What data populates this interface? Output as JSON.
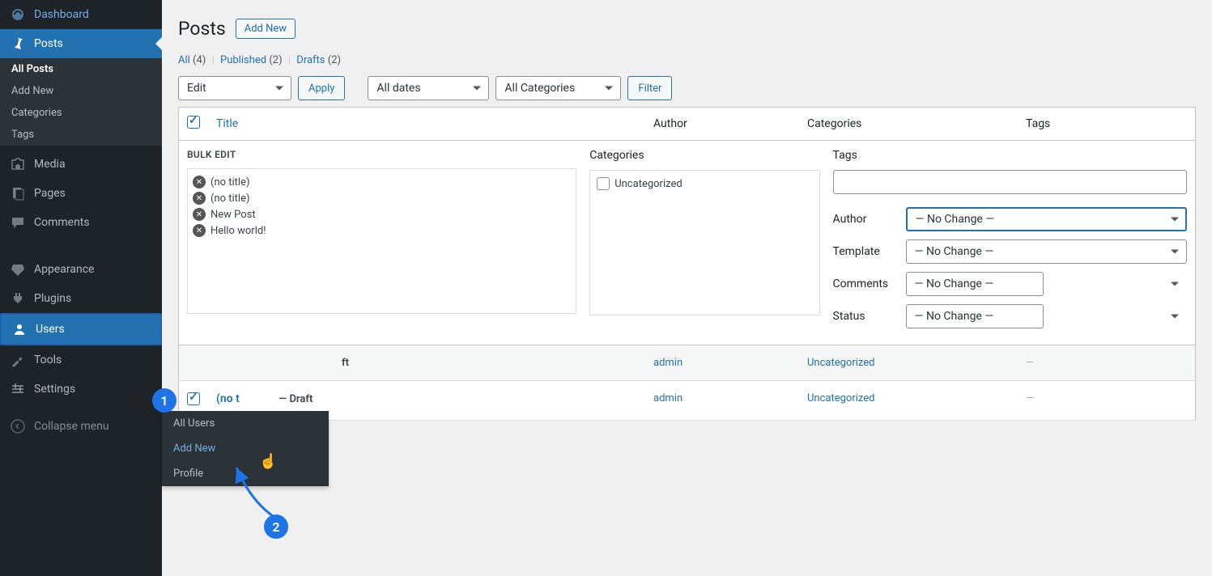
{
  "sidebar": {
    "items": [
      {
        "label": "Dashboard",
        "icon": "dashboard"
      },
      {
        "label": "Posts",
        "icon": "pin",
        "current": true,
        "submenu": [
          {
            "label": "All Posts",
            "current": true
          },
          {
            "label": "Add New"
          },
          {
            "label": "Categories"
          },
          {
            "label": "Tags"
          }
        ]
      },
      {
        "label": "Media",
        "icon": "media"
      },
      {
        "label": "Pages",
        "icon": "pages"
      },
      {
        "label": "Comments",
        "icon": "comments"
      },
      {
        "label": "Appearance",
        "icon": "appearance"
      },
      {
        "label": "Plugins",
        "icon": "plugins"
      },
      {
        "label": "Users",
        "icon": "users",
        "highlighted": true
      },
      {
        "label": "Tools",
        "icon": "tools"
      },
      {
        "label": "Settings",
        "icon": "settings"
      },
      {
        "label": "Collapse menu",
        "icon": "collapse"
      }
    ],
    "flyout": {
      "items": [
        {
          "label": "All Users"
        },
        {
          "label": "Add New",
          "hover": true
        },
        {
          "label": "Profile"
        }
      ]
    }
  },
  "page": {
    "title": "Posts",
    "add_new": "Add New"
  },
  "subsubsub": {
    "all": {
      "label": "All",
      "count": "(4)"
    },
    "published": {
      "label": "Published",
      "count": "(2)"
    },
    "drafts": {
      "label": "Drafts",
      "count": "(2)"
    }
  },
  "tablenav": {
    "bulk_action": "Edit",
    "apply": "Apply",
    "dates": "All dates",
    "categories": "All Categories",
    "filter": "Filter"
  },
  "table": {
    "headers": {
      "title": "Title",
      "author": "Author",
      "categories": "Categories",
      "tags": "Tags"
    }
  },
  "bulk_edit": {
    "title": "BULK EDIT",
    "posts": [
      {
        "title": "(no title)"
      },
      {
        "title": "(no title)"
      },
      {
        "title": "New Post"
      },
      {
        "title": "Hello world!"
      }
    ],
    "cats_label": "Categories",
    "cat_items": [
      {
        "label": "Uncategorized"
      }
    ],
    "tags_label": "Tags",
    "fields": {
      "author": {
        "label": "Author",
        "value": "— No Change —"
      },
      "template": {
        "label": "Template",
        "value": "— No Change —"
      },
      "comments": {
        "label": "Comments",
        "value": "— No Change —"
      },
      "status": {
        "label": "Status",
        "value": "— No Change —"
      }
    }
  },
  "rows": [
    {
      "title_suffix": "ft",
      "state": "",
      "author": "admin",
      "categories": "Uncategorized",
      "tags": "—"
    },
    {
      "title": "(no t",
      "title_suffix": "— Draft",
      "author": "admin",
      "categories": "Uncategorized",
      "tags": "—"
    }
  ],
  "callouts": {
    "one": "1",
    "two": "2"
  }
}
